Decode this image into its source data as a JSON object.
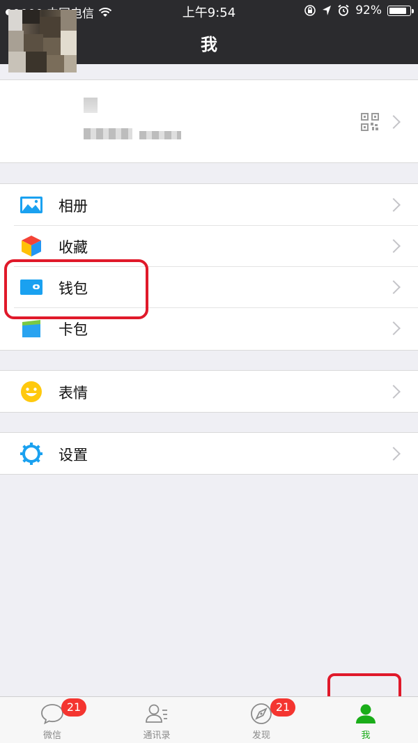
{
  "status_bar": {
    "carrier": "中国电信",
    "time": "上午9:54",
    "battery_pct": "92%",
    "battery_level": 0.92
  },
  "nav": {
    "title": "我"
  },
  "menu": {
    "group1": [
      {
        "label": "相册",
        "icon": "album-icon"
      },
      {
        "label": "收藏",
        "icon": "favorites-cube-icon"
      },
      {
        "label": "钱包",
        "icon": "wallet-icon"
      },
      {
        "label": "卡包",
        "icon": "card-pack-icon"
      }
    ],
    "group2": [
      {
        "label": "表情",
        "icon": "smiley-icon"
      }
    ],
    "group3": [
      {
        "label": "设置",
        "icon": "settings-gear-icon"
      }
    ]
  },
  "tabbar": {
    "tabs": [
      {
        "label": "微信",
        "badge": "21",
        "icon": "chat-bubble-icon"
      },
      {
        "label": "通讯录",
        "badge": "",
        "icon": "contacts-icon"
      },
      {
        "label": "发现",
        "badge": "21",
        "icon": "compass-icon"
      },
      {
        "label": "我",
        "badge": "",
        "icon": "me-person-icon"
      }
    ],
    "active_color": "#1aad19"
  },
  "colors": {
    "header_bg": "#2b2b2e",
    "page_bg": "#efeff4",
    "highlight_ring": "#e0192a",
    "badge_bg": "#f43530"
  }
}
